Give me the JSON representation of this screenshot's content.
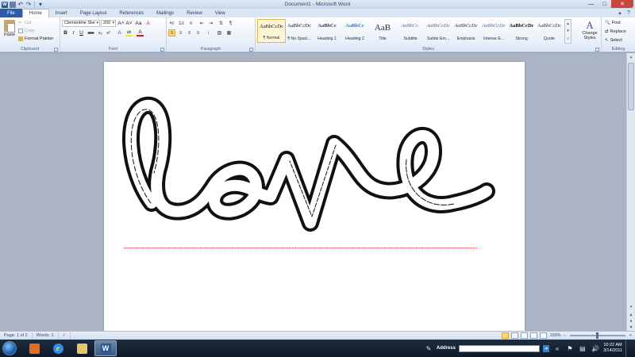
{
  "window": {
    "title": "Document1 - Microsoft Word",
    "controls": {
      "minimize": "—",
      "maximize": "□",
      "close": "✕"
    }
  },
  "quick_access": {
    "app_icon_letter": "W",
    "undo_glyph": "↶",
    "redo_glyph": "↷",
    "dropdown_glyph": "▾"
  },
  "ribbon_tabs": [
    {
      "label": "File"
    },
    {
      "label": "Home"
    },
    {
      "label": "Insert"
    },
    {
      "label": "Page Layout"
    },
    {
      "label": "References"
    },
    {
      "label": "Mailings"
    },
    {
      "label": "Review"
    },
    {
      "label": "View"
    }
  ],
  "ribbon_help_glyph": "?",
  "clipboard": {
    "label": "Clipboard",
    "paste": "Paste",
    "cut": "Cut",
    "copy": "Copy",
    "format_painter": "Format Painter"
  },
  "font": {
    "label": "Font",
    "family": "Clementine Ske",
    "size": "200",
    "grow": "A˄",
    "shrink": "A˅",
    "bold": "B",
    "italic": "I",
    "underline": "U",
    "strike": "abc",
    "subscript": "x₂",
    "superscript": "x²",
    "clear_format": "A",
    "highlight": "ab",
    "font_color": "A",
    "font_color_hex": "#d22020",
    "highlight_hex": "#f5e82a"
  },
  "paragraph": {
    "label": "Paragraph",
    "bullets": "•≡",
    "numbering": "1≡",
    "multilevel": "≡",
    "decrease_indent": "⇤",
    "increase_indent": "⇥",
    "sort": "⇅",
    "pilcrow": "¶",
    "align_left": "≡",
    "align_center": "≡",
    "align_right": "≡",
    "justify": "≡",
    "line_spacing": "↕",
    "shading": "▧",
    "borders": "▦"
  },
  "styles": {
    "label": "Styles",
    "items": [
      {
        "preview": "AaBbCcDc",
        "name": "¶ Normal",
        "color": "#111111"
      },
      {
        "preview": "AaBbCcDc",
        "name": "¶ No Spaci...",
        "color": "#111111"
      },
      {
        "preview": "AaBbCc",
        "name": "Heading 1",
        "color": "#1f3d7a"
      },
      {
        "preview": "AaBbCc",
        "name": "Heading 2",
        "color": "#3f6fb5"
      },
      {
        "preview": "AaB",
        "name": "Title",
        "color": "#1f2f4a"
      },
      {
        "preview": "AaBbCc.",
        "name": "Subtitle",
        "color": "#4a78b8"
      },
      {
        "preview": "AaBbCcDc",
        "name": "Subtle Em...",
        "color": "#666666"
      },
      {
        "preview": "AaBbCcDc",
        "name": "Emphasis",
        "color": "#333333"
      },
      {
        "preview": "AaBbCcDc",
        "name": "Intense E...",
        "color": "#3f6fb5"
      },
      {
        "preview": "AaBbCcDc",
        "name": "Strong",
        "color": "#111111"
      },
      {
        "preview": "AaBbCcDc",
        "name": "Quote",
        "color": "#333333"
      }
    ],
    "active_index": 0,
    "change_styles": "Change Styles",
    "change_styles_glyph": "A"
  },
  "editing": {
    "label": "Editing",
    "find": "Find",
    "replace": "Replace",
    "select": "Select"
  },
  "document": {
    "body_text": "love"
  },
  "status": {
    "page": "Page: 1 of 2",
    "words": "Words: 1",
    "zoom": "100%",
    "zoom_percent": 100
  },
  "taskbar": {
    "address_label": "Address",
    "address_value": "",
    "time": "10:22 AM",
    "date": "3/14/2011",
    "ie_letter": "e",
    "word_letter": "W"
  }
}
